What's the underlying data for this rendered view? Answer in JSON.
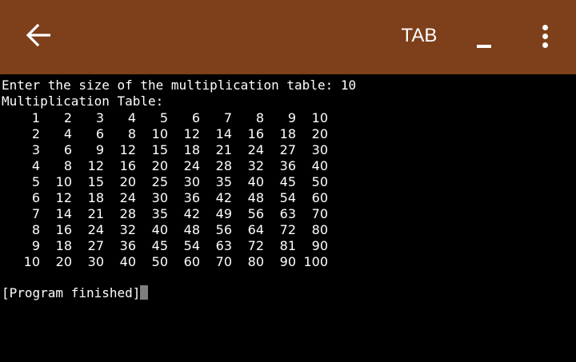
{
  "app_bar": {
    "background": "#7e3f1b",
    "back_icon": "arrow-left-icon",
    "tab_label": "TAB",
    "minimize_label": "_",
    "menu_icon": "more-vert-icon"
  },
  "terminal": {
    "prompt_line": "Enter the size of the multiplication table: 10",
    "heading_line": "Multiplication Table:",
    "table_rows": [
      [
        "1",
        "2",
        "3",
        "4",
        "5",
        "6",
        "7",
        "8",
        "9",
        "10"
      ],
      [
        "2",
        "4",
        "6",
        "8",
        "10",
        "12",
        "14",
        "16",
        "18",
        "20"
      ],
      [
        "3",
        "6",
        "9",
        "12",
        "15",
        "18",
        "21",
        "24",
        "27",
        "30"
      ],
      [
        "4",
        "8",
        "12",
        "16",
        "20",
        "24",
        "28",
        "32",
        "36",
        "40"
      ],
      [
        "5",
        "10",
        "15",
        "20",
        "25",
        "30",
        "35",
        "40",
        "45",
        "50"
      ],
      [
        "6",
        "12",
        "18",
        "24",
        "30",
        "36",
        "42",
        "48",
        "54",
        "60"
      ],
      [
        "7",
        "14",
        "21",
        "28",
        "35",
        "42",
        "49",
        "56",
        "63",
        "70"
      ],
      [
        "8",
        "16",
        "24",
        "32",
        "40",
        "48",
        "56",
        "64",
        "72",
        "80"
      ],
      [
        "9",
        "18",
        "27",
        "36",
        "45",
        "54",
        "63",
        "72",
        "81",
        "90"
      ],
      [
        "10",
        "20",
        "30",
        "40",
        "50",
        "60",
        "70",
        "80",
        "90",
        "100"
      ]
    ],
    "finished_line": "[Program finished]",
    "cursor_color": "#7f7f7f"
  }
}
